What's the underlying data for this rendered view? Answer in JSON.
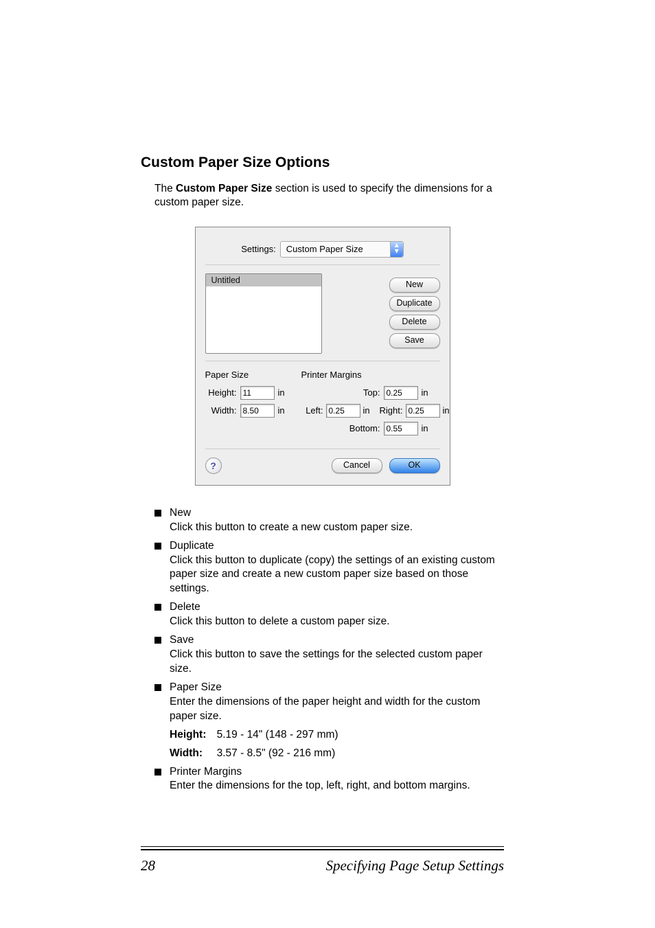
{
  "heading": "Custom Paper Size Options",
  "intro_pre": "The ",
  "intro_bold": "Custom Paper Size",
  "intro_post": " section is used to specify the dimensions for a custom paper size.",
  "dialog": {
    "settings_label": "Settings:",
    "settings_value": "Custom Paper Size",
    "list_selected": "Untitled",
    "buttons": {
      "new": "New",
      "duplicate": "Duplicate",
      "delete": "Delete",
      "save": "Save"
    },
    "paper_size_header": "Paper Size",
    "printer_margins_header": "Printer Margins",
    "height_label": "Height:",
    "width_label": "Width:",
    "top_label": "Top:",
    "left_label": "Left:",
    "right_label": "Right:",
    "bottom_label": "Bottom:",
    "height_value": "11",
    "width_value": "8.50",
    "top_value": "0.25",
    "left_value": "0.25",
    "right_value": "0.25",
    "bottom_value": "0.55",
    "unit": "in",
    "cancel": "Cancel",
    "ok": "OK",
    "help_glyph": "?"
  },
  "options": {
    "new_title": "New",
    "new_desc": "Click this button to create a new custom paper size.",
    "dup_title": "Duplicate",
    "dup_desc": "Click this button to duplicate (copy) the settings of an existing custom paper size and create a new custom paper size based on those settings.",
    "del_title": "Delete",
    "del_desc": "Click this button to delete a custom paper size.",
    "save_title": "Save",
    "save_desc": "Click this button to save the settings for the selected custom paper size.",
    "size_title": "Paper Size",
    "size_desc": "Enter the dimensions of the paper height and width for the custom paper size.",
    "height_label": "Height",
    "height_range": "5.19 - 14\" (148 - 297 mm)",
    "width_label": "Width",
    "width_range": "3.57 - 8.5\" (92 - 216 mm)",
    "margins_title": "Printer Margins",
    "margins_desc": "Enter the dimensions for the top, left, right, and bottom margins."
  },
  "footer": {
    "page_number": "28",
    "section_title": "Specifying Page Setup Settings"
  }
}
